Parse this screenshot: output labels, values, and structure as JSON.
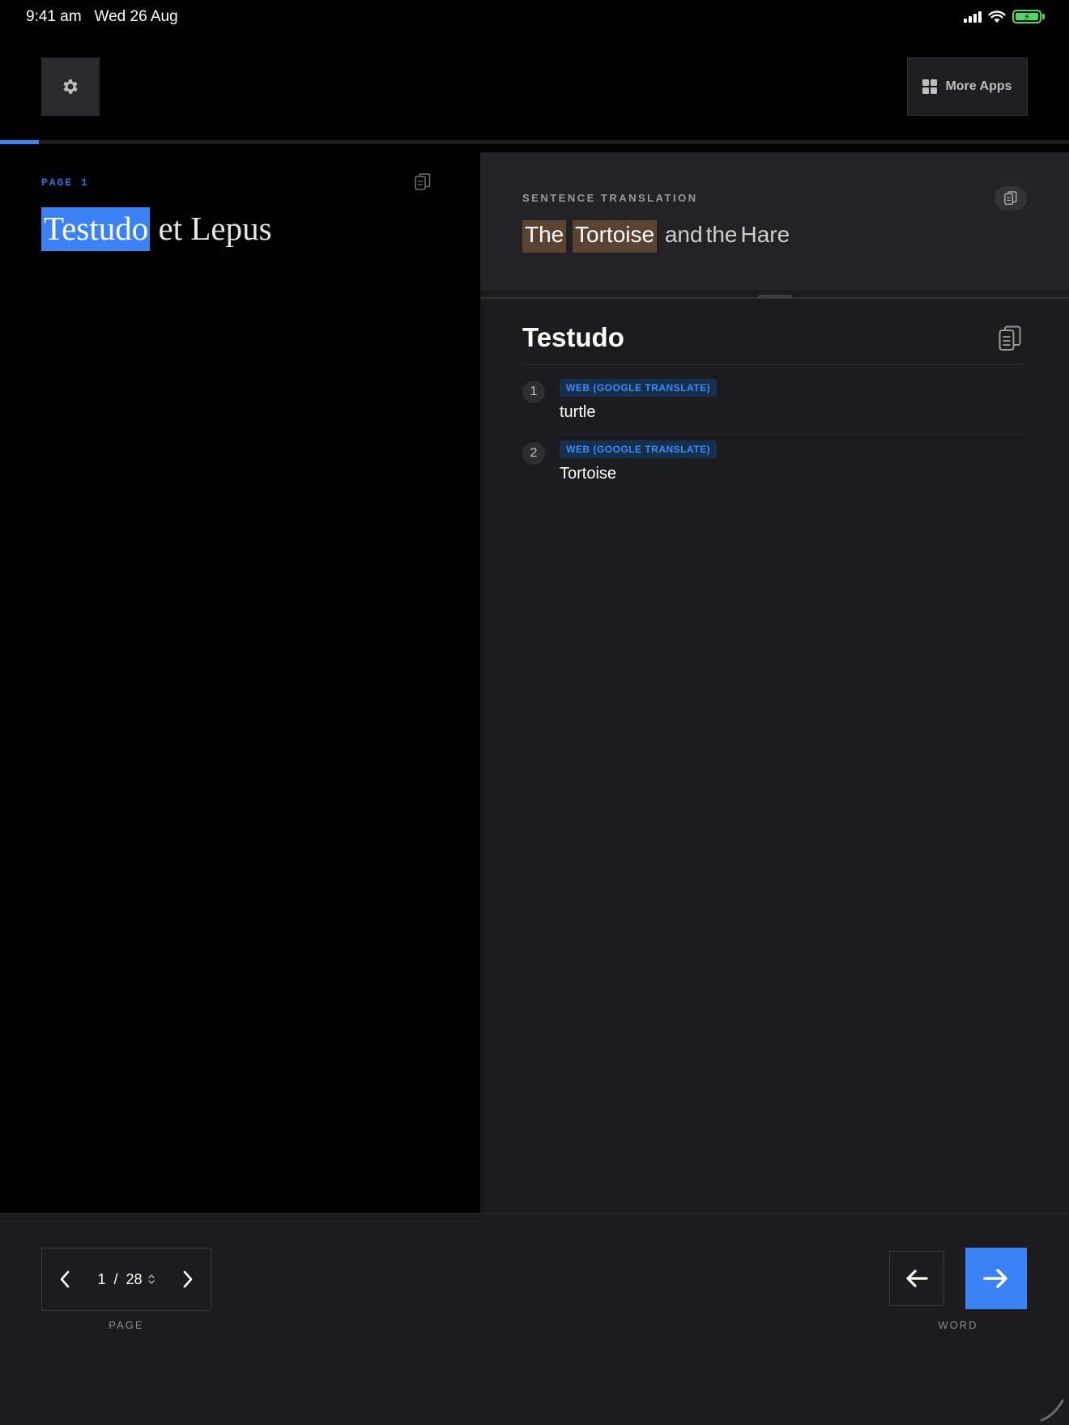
{
  "status_bar": {
    "time": "9:41 am",
    "date": "Wed 26 Aug",
    "battery_color": "#4cd964"
  },
  "toolbar": {
    "settings_icon": "gear-icon",
    "more_apps_label": "More Apps",
    "more_apps_icon": "grid-icon",
    "progress_fraction": 0.036
  },
  "reader": {
    "page_label": "PAGE 1",
    "words": [
      {
        "text": "Testudo",
        "selected": true
      },
      {
        "text": "et",
        "selected": false
      },
      {
        "text": "Lepus",
        "selected": false
      }
    ],
    "copy_icon": "copy-icon"
  },
  "sentence_translation": {
    "heading": "SENTENCE TRANSLATION",
    "words": [
      {
        "text": "The",
        "highlighted": true
      },
      {
        "text": "Tortoise",
        "highlighted": true
      },
      {
        "text": "and",
        "highlighted": false
      },
      {
        "text": "the",
        "highlighted": false
      },
      {
        "text": "Hare",
        "highlighted": false
      }
    ]
  },
  "word_panel": {
    "title": "Testudo",
    "definitions": [
      {
        "number": "1",
        "source": "WEB (GOOGLE TRANSLATE)",
        "text": "turtle"
      },
      {
        "number": "2",
        "source": "WEB (GOOGLE TRANSLATE)",
        "text": "Tortoise"
      }
    ]
  },
  "bottom_bar": {
    "page_current": "1",
    "page_separator": "/",
    "page_total": "28",
    "page_caption": "PAGE",
    "word_caption": "WORD"
  },
  "colors": {
    "accent": "#3b82f6",
    "highlight": "#5a4330",
    "source_badge_bg": "#15304f",
    "source_badge_text": "#3d8bf2"
  }
}
